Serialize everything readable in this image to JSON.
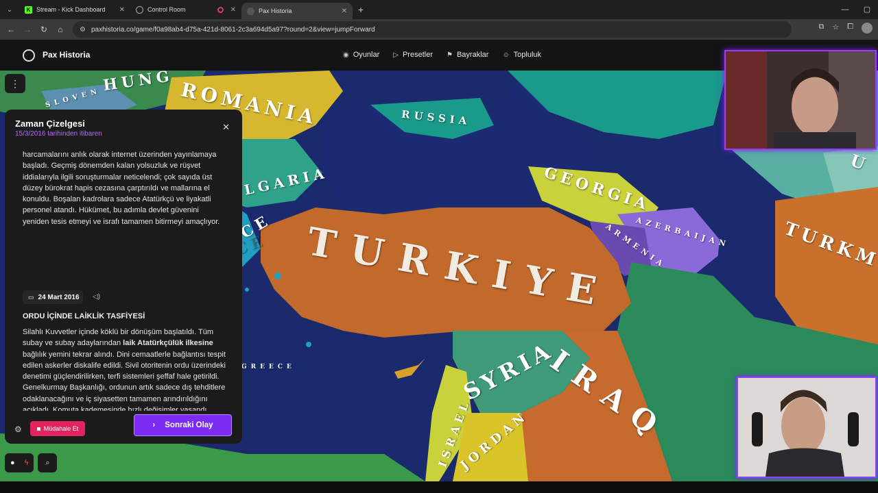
{
  "browser": {
    "tabs": [
      {
        "title": "Stream - Kick Dashboard",
        "favicon": "K"
      },
      {
        "title": "Control Room",
        "favicon": "globe"
      },
      {
        "title": "Pax Historia",
        "favicon": "pax"
      }
    ],
    "url": "paxhistoria.co/game/f0a98ab4-d75a-421d-8061-2c3a694d5a97?round=2&view=jumpForward"
  },
  "app": {
    "name": "Pax Historia",
    "nav": [
      {
        "label": "Oyunlar",
        "icon": "gamepad-icon"
      },
      {
        "label": "Presetler",
        "icon": "play-icon"
      },
      {
        "label": "Bayraklar",
        "icon": "flag-icon"
      },
      {
        "label": "Topluluk",
        "icon": "users-icon"
      }
    ]
  },
  "timeline": {
    "title": "Zaman Çizelgesi",
    "subtitle": "15/3/2016 tarihinden itibaren",
    "prev_event_text": "harcamalarını anlık olarak internet üzerinden yayınlamaya başladı. Geçmiş dönemden kalan yolsuzluk ve rüşvet iddialarıyla ilgili soruşturmalar neticelendi; çok sayıda üst düzey bürokrat hapis cezasına çarptırıldı ve mallarına el konuldu. Boşalan kadrolara sadece Atatürkçü ve liyakatli personel atandı. Hükümet, bu adımla devlet güvenini yeniden tesis etmeyi ve israfı tamamen bitirmeyi amaçlıyor.",
    "event": {
      "date": "24 Mart 2016",
      "title": "ORDU İÇİNDE LAİKLİK TASFİYESİ",
      "text_before": "Silahlı Kuvvetler içinde köklü bir dönüşüm başlatıldı. Tüm subay ve subay adaylarından ",
      "text_bold": "laik Atatürkçülük ilkesine",
      "text_after": " bağlılık yemini tekrar alındı. Dini cemaatlerle bağlantısı tespit edilen askerler diskalife edildi. Sivil otoritenin ordu üzerindeki denetimi güçlendirilirken, terfi sistemleri şeffaf hale getirildi. Genelkurmay Başkanlığı, ordunun artık sadece dış tehditlere odaklanacağını ve iç siyasetten tamamen arındırıldığını açıkladı. Komuta kademesinde hızlı değişimler yaşandı."
    },
    "intervene_label": "Müdahale Et",
    "next_label": "Sonraki Olay"
  },
  "map_labels": {
    "hungary": "HUNG",
    "slovenia": "SLOVEN",
    "romania": "ROMANIA",
    "russia": "RUSSIA",
    "bulgaria": "LGARIA",
    "greece_top": "CE",
    "greece_sea": "GREECE",
    "greece_small": "GREECE",
    "georgia": "GEORGIA",
    "azerbaijan": "AZERBAIJAN",
    "armenia": "ARMENIA",
    "turkiye": "TURKIYE",
    "turkmenistan": "TURKM",
    "syria": "SYRIA",
    "iraq": "IRAQ",
    "israel": "ISRAEL",
    "jordan": "JORDAN",
    "ukraine_frag": "U"
  },
  "colors": {
    "accent": "#7b2cf0",
    "subtitle": "#b46cff",
    "intervene": "#e0245e",
    "sea": "#1a2a6c",
    "turkiye": "#c2692c",
    "syria": "#3f9a7a",
    "iraq": "#c66a2e",
    "russia": "#1a9a8a",
    "romania": "#d7b72e"
  }
}
